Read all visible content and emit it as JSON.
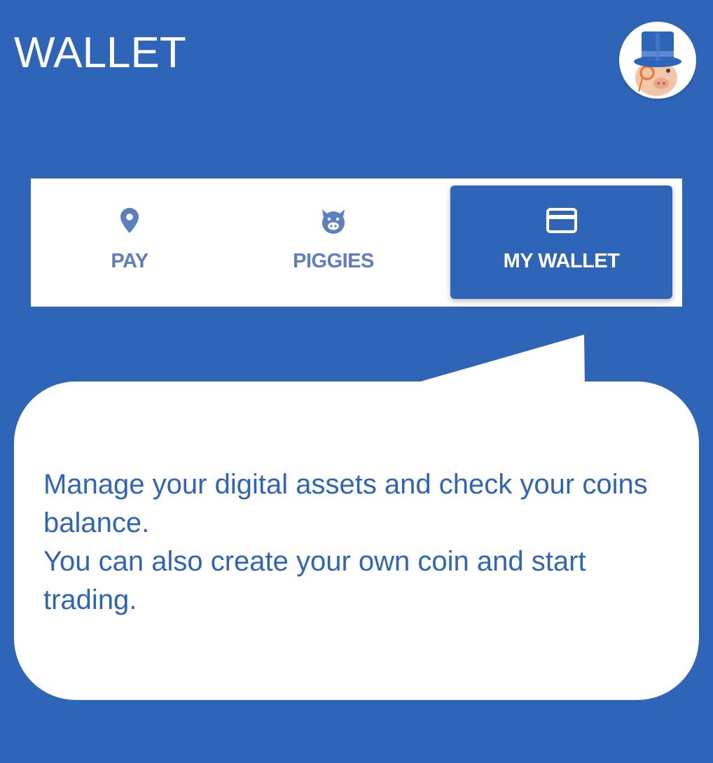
{
  "header": {
    "title": "WALLET",
    "avatar_icon": "pig-top-hat-mascot-icon"
  },
  "tabs": [
    {
      "label": "PAY",
      "icon": "location-pin-icon",
      "selected": false
    },
    {
      "label": "PIGGIES",
      "icon": "piggy-face-icon",
      "selected": false
    },
    {
      "label": "MY WALLET",
      "icon": "credit-card-icon",
      "selected": true
    }
  ],
  "tooltip": {
    "line1": "Manage your digital assets and check your coins balance.",
    "line2": "You can also create your own coin and start trading."
  },
  "colors": {
    "background": "#2f65b9",
    "tab_inactive": "#5d7fc0",
    "tab_active_bg": "#2f65b9",
    "bubble": "#ffffff",
    "bubble_text": "#2f65b9"
  }
}
